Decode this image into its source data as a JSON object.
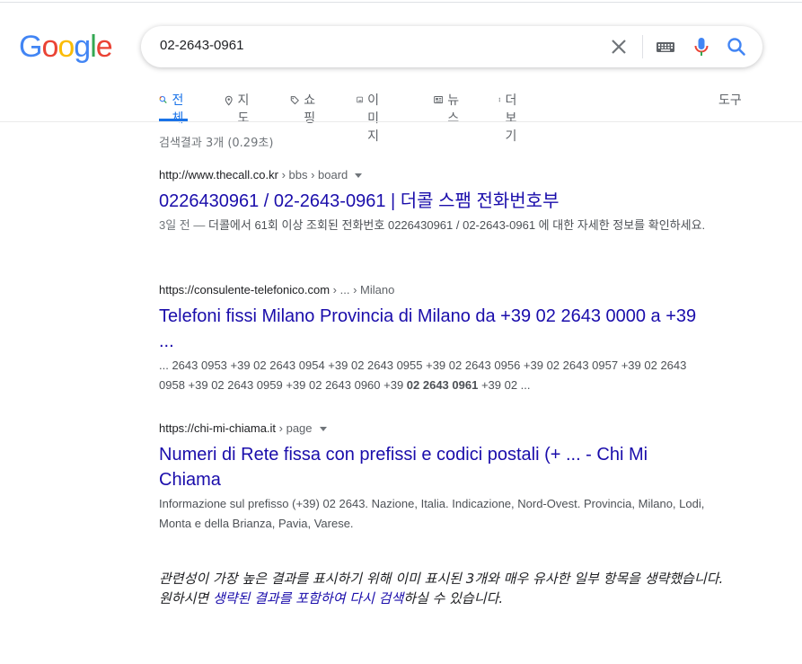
{
  "search": {
    "query": "02-2643-0961"
  },
  "logo": {
    "letters": [
      "G",
      "o",
      "o",
      "g",
      "l",
      "e"
    ],
    "colors": [
      "#4285F4",
      "#EA4335",
      "#FBBC05",
      "#4285F4",
      "#34A853",
      "#EA4335"
    ]
  },
  "tabs": [
    {
      "label": "전체",
      "icon": "search-icon",
      "active": true
    },
    {
      "label": "지도",
      "icon": "map-pin-icon"
    },
    {
      "label": "쇼핑",
      "icon": "tag-icon"
    },
    {
      "label": "이미지",
      "icon": "image-icon"
    },
    {
      "label": "뉴스",
      "icon": "news-icon"
    },
    {
      "label": "더보기",
      "icon": "more-vert-icon"
    }
  ],
  "tools_label": "도구",
  "stats": "검색결과 3개 (0.29초)",
  "results": [
    {
      "domain": "http://www.thecall.co.kr",
      "breadcrumb": " › bbs › board",
      "title": "0226430961 / 02-2643-0961 | 더콜 스팸 전화번호부",
      "date": "3일 전 — ",
      "snippet": "더콜에서 61회 이상 조회된 전화번호 0226430961 / 02-2643-0961 에 대한 자세한 정보를 확인하세요."
    },
    {
      "domain": "https://consulente-telefonico.com",
      "breadcrumb": " › ... › Milano",
      "title": "Telefoni fissi Milano Provincia di Milano da +39 02 2643 0000 a +39 ...",
      "snippet_pre": "... 2643 0953 +39 02 2643 0954 +39 02 2643 0955 +39 02 2643 0956 +39 02 2643 0957 +39 02 2643 0958 +39 02 2643 0959 +39 02 2643 0960 +39 ",
      "snippet_bold": "02 2643 0961",
      "snippet_post": " +39 02 ..."
    },
    {
      "domain": "https://chi-mi-chiama.it",
      "breadcrumb": " › page",
      "title": "Numeri di Rete fissa con prefissi e codici postali (+ ... - Chi Mi Chiama",
      "snippet": "Informazione sul prefisso (+39) 02 2643. Nazione, Italia. Indicazione, Nord-Ovest. Provincia, Milano, Lodi, Monta e della Brianza, Pavia, Varese."
    }
  ],
  "omitted": {
    "line1": "관련성이 가장 높은 결과를 표시하기 위해 이미 표시된 3개와 매우 유사한 일부 항목을 생략했습니다.",
    "line2_pre": "원하시면 ",
    "line2_link": "생략된 결과를 포함하여 다시 검색",
    "line2_post": "하실 수 있습니다."
  },
  "colors": {
    "link": "#1a0dab",
    "accent": "#1a73e8"
  }
}
